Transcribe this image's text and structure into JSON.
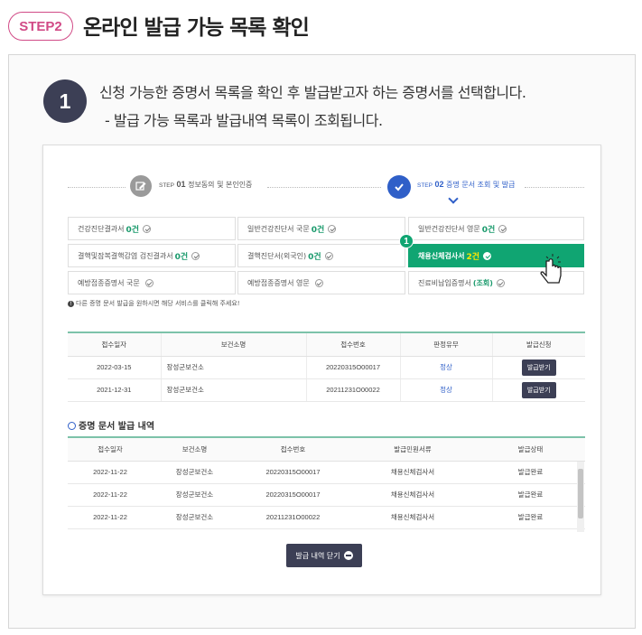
{
  "header": {
    "step_badge": "STEP2",
    "title": "온라인 발급 가능 목록 확인"
  },
  "instruction": {
    "number": "1",
    "line1": "신청 가능한 증명서 목록을 확인 후 발급받고자 하는 증명서를 선택합니다.",
    "line2": "-  발급 가능 목록과 발급내역 목록이 조회됩니다."
  },
  "stepper": {
    "step1_prefix": "STEP",
    "step1_num": "01",
    "step1_label": "정보동의 및 본인인증",
    "step2_prefix": "STEP",
    "step2_num": "02",
    "step2_label": "증명 문서 조회 및 발급"
  },
  "certificates": [
    {
      "name": "건강진단결과서",
      "count": "0건"
    },
    {
      "name": "일반건강진단서 국문",
      "count": "0건"
    },
    {
      "name": "일반건강진단서 영문",
      "count": "0건"
    },
    {
      "name": "결핵및잠복결핵감염 검진결과서",
      "count": "0건"
    },
    {
      "name": "결핵진단서(외국인)",
      "count": "0건"
    },
    {
      "name": "채용신체검사서",
      "count": "2건"
    },
    {
      "name": "예방접종증명서 국문",
      "count": ""
    },
    {
      "name": "예방접종증명서 영문",
      "count": ""
    },
    {
      "name": "진료비납입증명서",
      "count": "(조회)"
    }
  ],
  "selected_marker": "1",
  "notice": "다른 증명 문서 발급을 원하시면 해당 서비스를 클릭해 주세요!",
  "issue_table": {
    "headers": [
      "접수일자",
      "보건소명",
      "접수번호",
      "판정유무",
      "발급신청"
    ],
    "rows": [
      {
        "date": "2022-03-15",
        "center": "장성군보건소",
        "number": "20220315O00017",
        "result": "정상",
        "action": "발급받기"
      },
      {
        "date": "2021-12-31",
        "center": "장성군보건소",
        "number": "20211231O00022",
        "result": "정상",
        "action": "발급받기"
      }
    ]
  },
  "history": {
    "title": "증명 문서 발급 내역",
    "headers": [
      "접수일자",
      "보건소명",
      "접수번호",
      "발급민원서류",
      "발급상태"
    ],
    "rows": [
      {
        "date": "2022-11-22",
        "center": "장성군보건소",
        "number": "20220315O00017",
        "doc": "채용신체검사서",
        "status": "발급완료"
      },
      {
        "date": "2022-11-22",
        "center": "장성군보건소",
        "number": "20220315O00017",
        "doc": "채용신체검사서",
        "status": "발급완료"
      },
      {
        "date": "2022-11-22",
        "center": "장성군보건소",
        "number": "20211231O00022",
        "doc": "채용신체검사서",
        "status": "발급완료"
      }
    ],
    "close_button": "발급 내역 닫기"
  },
  "colors": {
    "accent_pink": "#d14a86",
    "selected_green": "#10a572",
    "count_green": "#1a9a6c",
    "navy": "#3c3f55",
    "step_blue": "#2f5fc8"
  }
}
